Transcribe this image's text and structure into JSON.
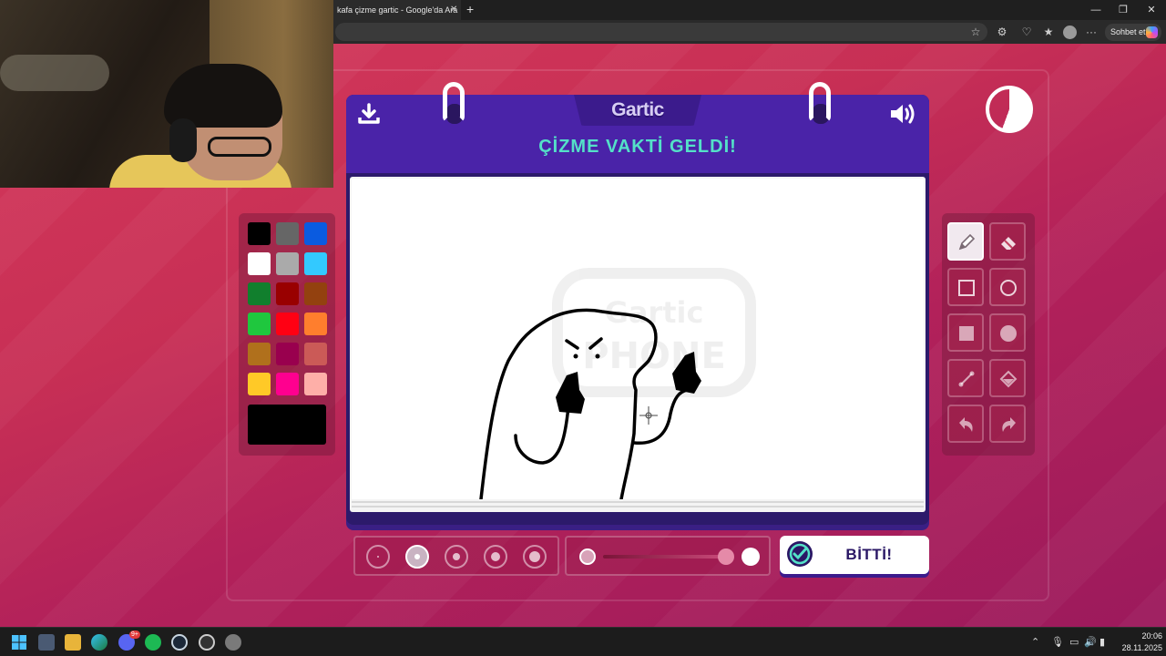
{
  "browser": {
    "tab_title": "kafa çizme gartic - Google'da Ara",
    "tab_close": "✕",
    "new_tab": "+",
    "chat_button": "Sohbet et",
    "window_minimize": "—",
    "window_restore": "❐",
    "window_close": "✕"
  },
  "game": {
    "logo": "Gartic",
    "title": "ÇİZME VAKTİ GELDİ!",
    "watermark": "Gartic PHONE",
    "done_label": "BİTTİ!",
    "palette": [
      "#000000",
      "#666666",
      "#0a5be0",
      "#ffffff",
      "#aaaaaa",
      "#33c9ff",
      "#117f2d",
      "#990000",
      "#93410f",
      "#1fc73e",
      "#ff0013",
      "#ff7e2d",
      "#b0701c",
      "#99004e",
      "#cb5a57",
      "#ffc927",
      "#ff008f",
      "#feafa8"
    ],
    "current_color": "#000000",
    "active_tool": "pencil",
    "tools": [
      "pencil",
      "eraser",
      "rectangle",
      "ellipse",
      "filled-rectangle",
      "filled-ellipse",
      "line",
      "fill-bucket",
      "undo",
      "redo"
    ],
    "selected_brush_size_index": 1
  },
  "taskbar": {
    "time": "20:06",
    "date": "28.11.2025",
    "discord_badge": "9+"
  },
  "colors": {
    "board": "#4a23a8",
    "title": "#54e1c8",
    "background": "#c72f55"
  }
}
